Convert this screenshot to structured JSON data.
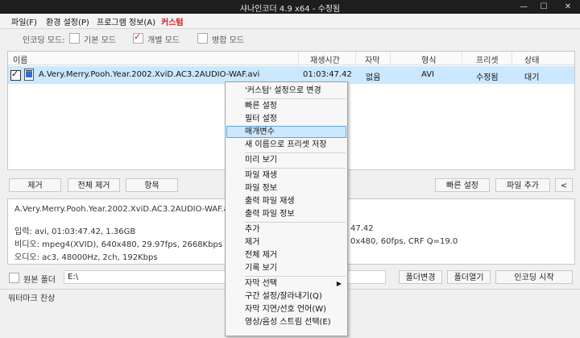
{
  "window": {
    "title": "샤나인코더 4.9 x64 - 수정됨",
    "minimize": "—",
    "maximize": "☐",
    "close": "✕"
  },
  "menubar": [
    "파일(F)",
    "환경 설정(P)",
    "프로그램 정보(A)",
    "커스텀"
  ],
  "encoding_mode": {
    "label": "인코딩 모드:",
    "options": [
      {
        "label": "기본 모드",
        "checked": false
      },
      {
        "label": "개별 모드",
        "checked": true
      },
      {
        "label": "병합 모드",
        "checked": false
      }
    ]
  },
  "file_list": {
    "columns": [
      "이름",
      "재생시간",
      "자막",
      "형식",
      "프리셋",
      "상태"
    ],
    "rows": [
      {
        "checked": true,
        "name": "A.Very.Merry.Pooh.Year.2002.XviD.AC3.2AUDIO-WAF.avi",
        "duration": "01:03:47.42",
        "subtitle": "없음",
        "format": "AVI",
        "preset": "수정됨",
        "status": "대기"
      }
    ]
  },
  "buttons": {
    "remove": "제거",
    "remove_all": "전체 제거",
    "items": "항목",
    "quick_settings": "빠른 설정",
    "add_file": "파일 추가",
    "more": "<",
    "change_folder": "폴더변경",
    "open_folder": "폴더열기",
    "start_encoding": "인코딩 시작"
  },
  "info": {
    "filename": "A.Very.Merry.Pooh.Year.2002.XviD.AC3.2AUDIO-WAF.avi",
    "input": "입력: avi, 01:03:47.42, 1.36GB",
    "video": "비디오: mpeg4(XVID), 640x480, 29.97fps, 2668Kbps",
    "audio": "오디오: ac3, 48000Hz, 2ch, 192Kbps",
    "out_duration": "47.42",
    "out_video": "0x480, 60fps, CRF Q=19.0"
  },
  "folder": {
    "source_label": "원본 폴더",
    "path": "E:\\"
  },
  "status": {
    "watermark": "워터마크 찬상"
  },
  "context_menu": [
    {
      "label": "'커스텀' 설정으로 변경",
      "sep_after": true
    },
    {
      "label": "빠른 설정"
    },
    {
      "label": "필터 설정"
    },
    {
      "label": "매개변수",
      "highlight": true
    },
    {
      "label": "새 이름으로 프리셋 저장",
      "sep_after": true
    },
    {
      "label": "미리 보기",
      "sep_after": true
    },
    {
      "label": "파일 재생"
    },
    {
      "label": "파일 정보"
    },
    {
      "label": "출력 파일 재생"
    },
    {
      "label": "출력 파일 정보",
      "sep_after": true
    },
    {
      "label": "추가"
    },
    {
      "label": "제거"
    },
    {
      "label": "전체 제거"
    },
    {
      "label": "기록 보기",
      "sep_after": true
    },
    {
      "label": "자막 선택",
      "submenu": true
    },
    {
      "label": "구간 설정/잘라내기(Q)"
    },
    {
      "label": "자막 지연/선호 언어(W)"
    },
    {
      "label": "영상/음성 스트림 선택(E)"
    }
  ]
}
